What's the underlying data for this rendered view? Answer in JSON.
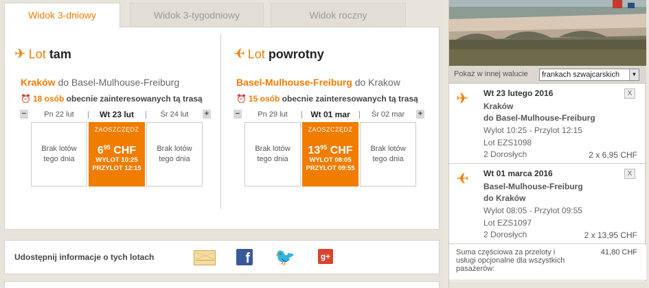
{
  "tabs": [
    {
      "label": "Widok 3-dniowy",
      "active": true
    },
    {
      "label": "Widok 3-tygodniowy",
      "active": false
    },
    {
      "label": "Widok roczny",
      "active": false
    }
  ],
  "outbound": {
    "title_prefix": "Lot",
    "title_word": "tam",
    "route_from": "Kraków",
    "route_rest": "do Basel-Mulhouse-Freiburg",
    "interest_count": "18 osób",
    "interest_text": "obecnie zainteresowanych tą trasą",
    "prev_arrow": "−",
    "next_arrow": "+",
    "days": [
      "Pn 22 lut",
      "Wt 23 lut",
      "Śr 24 lut"
    ],
    "no_flights_1": "Brak lotów tego dnia",
    "no_flights_3": "Brak lotów tego dnia",
    "best": {
      "save_label": "ZAOSZCZĘDŹ",
      "price_int": "6",
      "price_dec": "95",
      "currency": "CHF",
      "depart": "WYLOT 10:25",
      "arrive": "PRZYLOT 12:15"
    }
  },
  "return": {
    "title_prefix": "Lot",
    "title_word": "powrotny",
    "route_from": "Basel-Mulhouse-Freiburg",
    "route_rest": "do Krakow",
    "interest_count": "15 osób",
    "interest_text": "obecnie zainteresowanych tą trasą",
    "prev_arrow": "−",
    "next_arrow": "+",
    "days": [
      "Pn 29 lut",
      "Wt 01 mar",
      "Śr 02 mar"
    ],
    "no_flights_1": "Brak lotów tego dnia",
    "no_flights_3": "Brak lotów tego dnia",
    "best": {
      "save_label": "ZAOSZCZĘDŹ",
      "price_int": "13",
      "price_dec": "95",
      "currency": "CHF",
      "depart": "WYLOT 08:05",
      "arrive": "PRZYLOT 09:55"
    }
  },
  "share": {
    "label": "Udostępnij informacje o tych lotach",
    "icons": [
      "email-icon",
      "facebook-icon",
      "twitter-icon",
      "google-plus-icon"
    ],
    "fb_glyph": "f",
    "tw_glyph": "🐦",
    "gp_glyph": "g+"
  },
  "sidebar": {
    "currency_label": "Pokaż w innej walucie",
    "currency_value": "frankach szwajcarskich",
    "flights": [
      {
        "date": "Wt 23 lutego 2016",
        "from": "Kraków",
        "to": "do Basel-Mulhouse-Freiburg",
        "times": "Wylot 10:25 - Przylot 12:15",
        "flight_no": "Lot EZS1098",
        "pax": "2 Dorosłych",
        "price": "2 x 6,95 CHF",
        "remove": "X"
      },
      {
        "date": "Wt 01 marca 2016",
        "from": "Basel-Mulhouse-Freiburg",
        "to": "do Kraków",
        "times": "Wylot 08:05 - Przylot 09:55",
        "flight_no": "Lot EZS1097",
        "pax": "2 Dorosłych",
        "price": "2 x 13,95 CHF",
        "remove": "X"
      }
    ],
    "subtotal_label": "Suma częściowa za przeloty i usługi opcjonalne dla wszystkich pasażerów:",
    "subtotal_value": "41,80 CHF"
  },
  "colors": {
    "accent": "#f07c00",
    "facebook": "#3b5998",
    "twitter": "#39a9e0",
    "google_plus": "#d9442f"
  }
}
